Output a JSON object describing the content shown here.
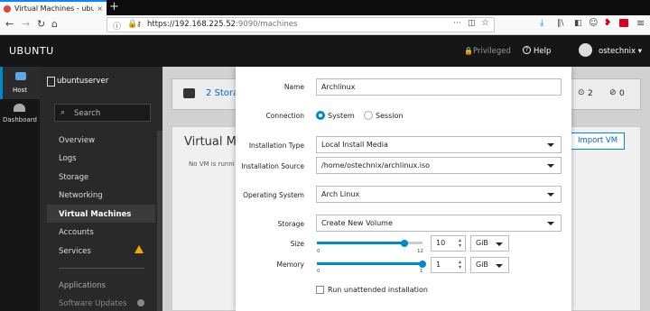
{
  "browser": {
    "tab_title": "Virtual Machines - ubuntu",
    "tab_close": "×",
    "new_tab": "+",
    "url_prefix": "https://192.168.225.52",
    "url_suffix": ":9090/machines",
    "url_menu": "···"
  },
  "header": {
    "brand": "UBUNTU",
    "privileged": "Privileged",
    "help": "Help",
    "user": "ostechnix ▾"
  },
  "rail": {
    "host": "Host",
    "dashboard": "Dashboard"
  },
  "sidebar": {
    "server": "ubuntuserver",
    "search_placeholder": "Search",
    "items": [
      "Overview",
      "Logs",
      "Storage",
      "Networking",
      "Virtual Machines",
      "Accounts",
      "Services",
      "Applications",
      "Software Updates"
    ]
  },
  "main": {
    "storage_pools": "2 Stora",
    "count_a": "2",
    "count_b": "0",
    "title": "Virtual Ma",
    "empty": "No VM is runni",
    "import_button": "Import VM"
  },
  "dialog": {
    "name_label": "Name",
    "name_value": "Archlinux",
    "connection_label": "Connection",
    "conn_system": "System",
    "conn_session": "Session",
    "install_type_label": "Installation Type",
    "install_type_value": "Local Install Media",
    "install_source_label": "Installation Source",
    "install_source_value": "/home/ostechnix/archlinux.iso",
    "os_label": "Operating System",
    "os_value": "Arch Linux",
    "storage_label": "Storage",
    "storage_value": "Create New Volume",
    "size_label": "Size",
    "size_value": "10",
    "size_unit": "GiB",
    "size_min": "0",
    "size_max": "12",
    "size_fraction": 0.83,
    "memory_label": "Memory",
    "memory_value": "1",
    "memory_unit": "GiB",
    "memory_min": "0",
    "memory_max": "1",
    "memory_fraction": 1.0,
    "unattended_label": "Run unattended installation"
  }
}
